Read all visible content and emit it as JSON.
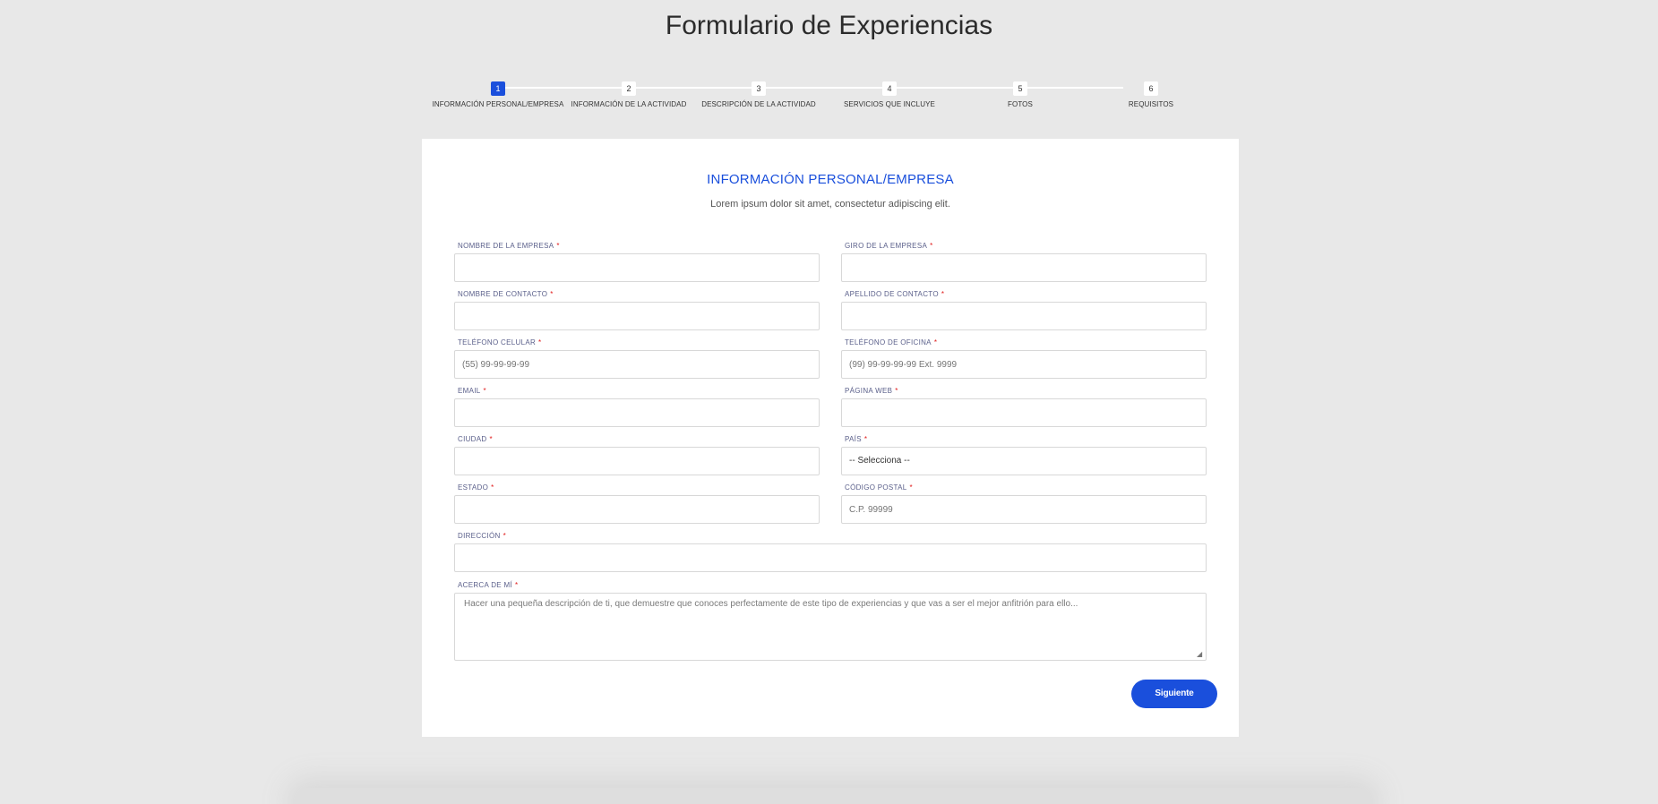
{
  "page": {
    "title": "Formulario de Experiencias"
  },
  "stepper": {
    "steps": [
      {
        "number": "1",
        "label": "INFORMACIÓN PERSONAL/EMPRESA",
        "active": true
      },
      {
        "number": "2",
        "label": "INFORMACIÓN DE LA ACTIVIDAD",
        "active": false
      },
      {
        "number": "3",
        "label": "DESCRIPCIÓN DE LA ACTIVIDAD",
        "active": false
      },
      {
        "number": "4",
        "label": "SERVICIOS QUE INCLUYE",
        "active": false
      },
      {
        "number": "5",
        "label": "FOTOS",
        "active": false
      },
      {
        "number": "6",
        "label": "REQUISITOS",
        "active": false
      }
    ]
  },
  "form": {
    "title": "INFORMACIÓN PERSONAL/EMPRESA",
    "subtitle": "Lorem ipsum dolor sit amet, consectetur adipiscing elit.",
    "required_mark": "*",
    "fields": {
      "company_name": {
        "label": "NOMBRE DE LA EMPRESA",
        "value": "",
        "placeholder": ""
      },
      "business_line": {
        "label": "GIRO DE LA EMPRESA",
        "value": "",
        "placeholder": ""
      },
      "contact_name": {
        "label": "NOMBRE DE CONTACTO",
        "value": "",
        "placeholder": ""
      },
      "contact_lastname": {
        "label": "APELLIDO DE CONTACTO",
        "value": "",
        "placeholder": ""
      },
      "mobile_phone": {
        "label": "TELÉFONO CELULAR",
        "value": "",
        "placeholder": "(55) 99-99-99-99"
      },
      "office_phone": {
        "label": "TELÉFONO DE OFICINA",
        "value": "",
        "placeholder": "(99) 99-99-99-99 Ext. 9999"
      },
      "email": {
        "label": "EMAIL",
        "value": "",
        "placeholder": ""
      },
      "website": {
        "label": "PÁGINA WEB",
        "value": "",
        "placeholder": ""
      },
      "city": {
        "label": "CIUDAD",
        "value": "",
        "placeholder": ""
      },
      "country": {
        "label": "PAÍS",
        "selected": "-- Selecciona --"
      },
      "state": {
        "label": "ESTADO",
        "value": "",
        "placeholder": ""
      },
      "postal_code": {
        "label": "CÓDIGO POSTAL",
        "value": "",
        "placeholder": "C.P. 99999"
      },
      "address": {
        "label": "DIRECCIÓN",
        "value": "",
        "placeholder": ""
      },
      "about_me": {
        "label": "ACERCA DE MÍ",
        "placeholder": "Hacer una pequeña descripción de ti, que demuestre que conoces perfectamente de este tipo de experiencias y que vas a ser el mejor anfitrión para ello..."
      }
    },
    "next_button": "Siguiente"
  },
  "colors": {
    "accent": "#1a4fdc",
    "background": "#e8e8e8",
    "required": "#e01a1a",
    "label": "#5a5f8a"
  }
}
